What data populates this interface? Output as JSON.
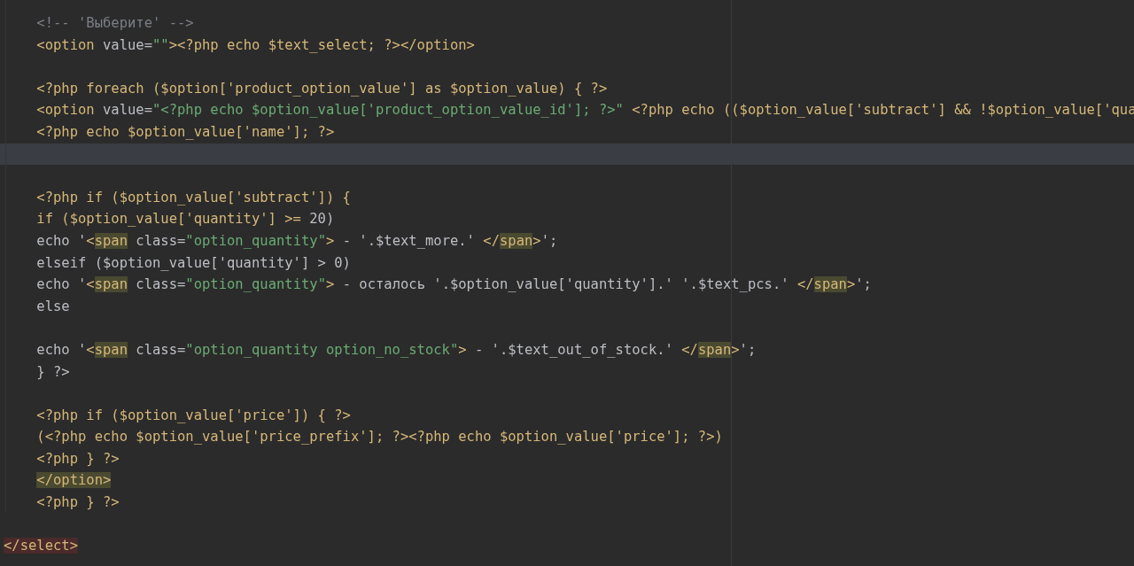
{
  "editor": {
    "lines": [
      {
        "current": false,
        "segments": [
          {
            "kind": "comment",
            "text": "    <!-- 'Выберите' -->"
          }
        ]
      },
      {
        "current": false,
        "segments": [
          {
            "kind": "tag",
            "text": "    <option"
          },
          {
            "kind": "text",
            "text": " value="
          },
          {
            "kind": "string",
            "text": "\"\""
          },
          {
            "kind": "tag",
            "text": "><?php echo $text_select; ?></option>"
          }
        ]
      },
      {
        "current": false
      },
      {
        "current": false,
        "segments": [
          {
            "kind": "tag",
            "text": "    <?php foreach ($option['product_option_value'] as $option_value) { ?>"
          }
        ]
      },
      {
        "current": false,
        "segments": [
          {
            "kind": "tag",
            "text": "    <option"
          },
          {
            "kind": "text",
            "text": " value="
          },
          {
            "kind": "string",
            "text": "\"<?php echo $option_value['product_option_value_id']; ?>\""
          },
          {
            "kind": "tag",
            "text": " <?php echo (($option_value['subtract'] && !$option_value['qua"
          }
        ]
      },
      {
        "current": false,
        "segments": [
          {
            "kind": "tag",
            "text": "    <?php echo $option_value['name']; ?>"
          }
        ]
      },
      {
        "current": true
      },
      {
        "current": false
      },
      {
        "current": false,
        "segments": [
          {
            "kind": "tag",
            "text": "    <?php if ($option_value['subtract']) {"
          }
        ]
      },
      {
        "current": false,
        "segments": [
          {
            "kind": "tag",
            "text": "    if ($option_value['quantity'] >= "
          },
          {
            "kind": "text",
            "text": "20)"
          }
        ]
      },
      {
        "current": false,
        "segments": [
          {
            "kind": "text",
            "text": "    echo '"
          },
          {
            "kind": "tag",
            "text": "<"
          },
          {
            "kind": "match",
            "text": "span"
          },
          {
            "kind": "text",
            "text": " class="
          },
          {
            "kind": "string",
            "text": "\"option_quantity\""
          },
          {
            "kind": "tag",
            "text": ">"
          },
          {
            "kind": "text",
            "text": " - '.$text_more.' "
          },
          {
            "kind": "tag",
            "text": "</"
          },
          {
            "kind": "match",
            "text": "span"
          },
          {
            "kind": "tag",
            "text": ">"
          },
          {
            "kind": "text",
            "text": "';"
          }
        ]
      },
      {
        "current": false,
        "segments": [
          {
            "kind": "text",
            "text": "    elseif ($option_value['quantity'] > 0)"
          }
        ]
      },
      {
        "current": false,
        "segments": [
          {
            "kind": "text",
            "text": "    echo '"
          },
          {
            "kind": "tag",
            "text": "<"
          },
          {
            "kind": "match",
            "text": "span"
          },
          {
            "kind": "text",
            "text": " class="
          },
          {
            "kind": "string",
            "text": "\"option_quantity\""
          },
          {
            "kind": "tag",
            "text": ">"
          },
          {
            "kind": "text",
            "text": " - осталось '.$option_value['quantity'].' '.$text_pcs.' "
          },
          {
            "kind": "tag",
            "text": "</"
          },
          {
            "kind": "match",
            "text": "span"
          },
          {
            "kind": "tag",
            "text": ">"
          },
          {
            "kind": "text",
            "text": "';"
          }
        ]
      },
      {
        "current": false,
        "segments": [
          {
            "kind": "text",
            "text": "    else"
          }
        ]
      },
      {
        "current": false
      },
      {
        "current": false,
        "segments": [
          {
            "kind": "text",
            "text": "    echo '"
          },
          {
            "kind": "tag",
            "text": "<"
          },
          {
            "kind": "match",
            "text": "span"
          },
          {
            "kind": "text",
            "text": " class="
          },
          {
            "kind": "string",
            "text": "\"option_quantity option_no_stock\""
          },
          {
            "kind": "tag",
            "text": ">"
          },
          {
            "kind": "text",
            "text": " - '.$text_out_of_stock.' "
          },
          {
            "kind": "tag",
            "text": "</"
          },
          {
            "kind": "match",
            "text": "span"
          },
          {
            "kind": "tag",
            "text": ">"
          },
          {
            "kind": "text",
            "text": "';"
          }
        ]
      },
      {
        "current": false,
        "segments": [
          {
            "kind": "text",
            "text": "    } ?>"
          }
        ]
      },
      {
        "current": false
      },
      {
        "current": false,
        "segments": [
          {
            "kind": "tag",
            "text": "    <?php if ($option_value['price']) { ?>"
          }
        ]
      },
      {
        "current": false,
        "segments": [
          {
            "kind": "tag",
            "text": "    (<?php echo $option_value['price_prefix']; ?><?php echo $option_value['price']; ?>)"
          }
        ]
      },
      {
        "current": false,
        "segments": [
          {
            "kind": "tag",
            "text": "    <?php } ?>"
          }
        ]
      },
      {
        "current": false,
        "segments": [
          {
            "kind": "match",
            "text": "    </option>"
          }
        ]
      },
      {
        "current": false,
        "segments": [
          {
            "kind": "tag",
            "text": "    <?php } ?>"
          }
        ]
      },
      {
        "current": false
      },
      {
        "current": false,
        "segments": [
          {
            "kind": "error",
            "text": "</select>"
          }
        ]
      }
    ]
  }
}
